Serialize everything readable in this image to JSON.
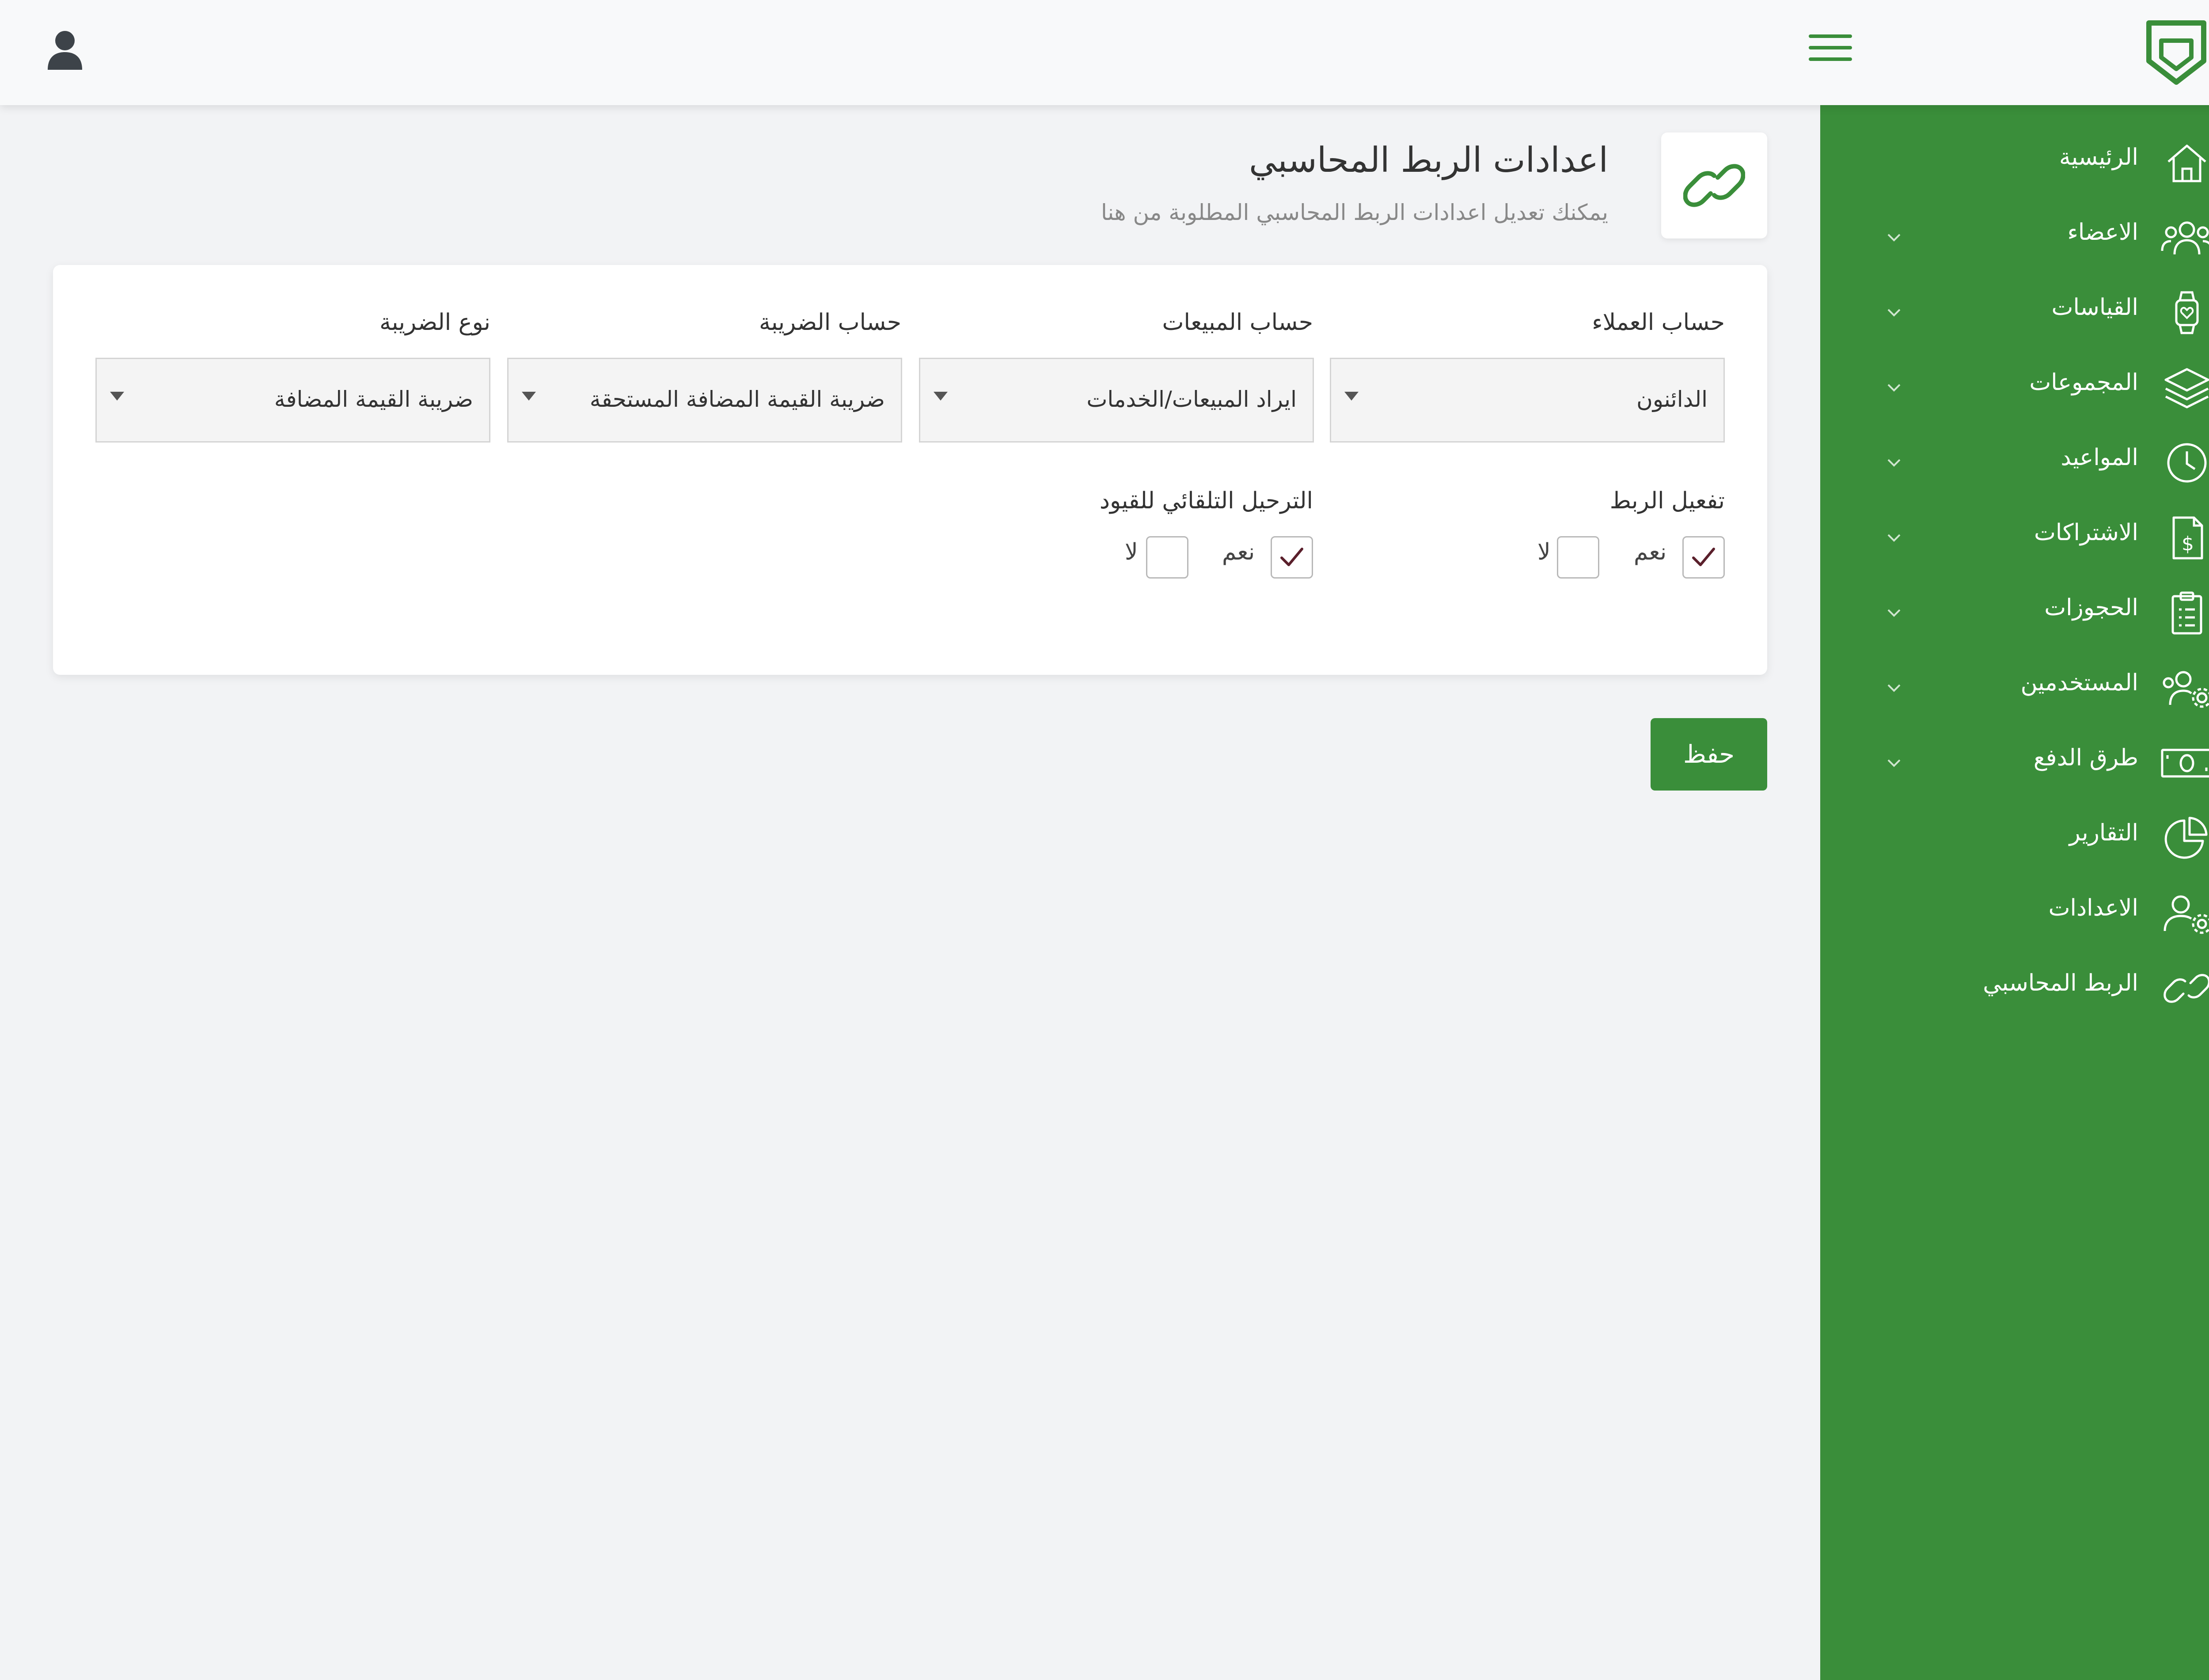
{
  "colors": {
    "brand": "#3a8e3a",
    "sidebar_text": "#ffffff",
    "check": "#5a1f2b"
  },
  "header": {
    "user_icon": "user-icon",
    "menu_icon": "hamburger-icon",
    "logo_icon": "shield-logo-icon"
  },
  "sidebar": {
    "items": [
      {
        "label": "الرئيسية",
        "icon": "home-icon",
        "has_submenu": false
      },
      {
        "label": "الاعضاء",
        "icon": "users-icon",
        "has_submenu": true
      },
      {
        "label": "القياسات",
        "icon": "smartwatch-icon",
        "has_submenu": true
      },
      {
        "label": "المجموعات",
        "icon": "layers-icon",
        "has_submenu": true
      },
      {
        "label": "المواعيد",
        "icon": "clock-icon",
        "has_submenu": true
      },
      {
        "label": "الاشتراكات",
        "icon": "invoice-icon",
        "has_submenu": true
      },
      {
        "label": "الحجوزات",
        "icon": "clipboard-icon",
        "has_submenu": true
      },
      {
        "label": "المستخدمين",
        "icon": "users-gear-icon",
        "has_submenu": true
      },
      {
        "label": "طرق الدفع",
        "icon": "money-icon",
        "has_submenu": true
      },
      {
        "label": "التقارير",
        "icon": "pie-chart-icon",
        "has_submenu": false
      },
      {
        "label": "الاعدادات",
        "icon": "user-gear-icon",
        "has_submenu": false
      },
      {
        "label": "الربط المحاسبي",
        "icon": "link-icon",
        "has_submenu": false
      }
    ]
  },
  "page": {
    "title": "اعدادات الربط المحاسبي",
    "subtitle": "يمكنك تعديل اعدادات الربط المحاسبي المطلوبة من هنا",
    "icon": "link-icon"
  },
  "form": {
    "customers_account": {
      "label": "حساب العملاء",
      "value": "الدائنون"
    },
    "sales_account": {
      "label": "حساب المبيعات",
      "value": "ايراد المبيعات/الخدمات"
    },
    "tax_account": {
      "label": "حساب الضريبة",
      "value": "ضريبة القيمة المضافة المستحقة"
    },
    "tax_type": {
      "label": "نوع الضريبة",
      "value": "ضريبة القيمة المضافة"
    },
    "enable_link": {
      "label": "تفعيل الربط",
      "yes_label": "نعم",
      "no_label": "لا",
      "value": "yes"
    },
    "auto_posting": {
      "label": "الترحيل التلقائي للقيود",
      "yes_label": "نعم",
      "no_label": "لا",
      "value": "yes"
    },
    "save_label": "حفظ"
  }
}
